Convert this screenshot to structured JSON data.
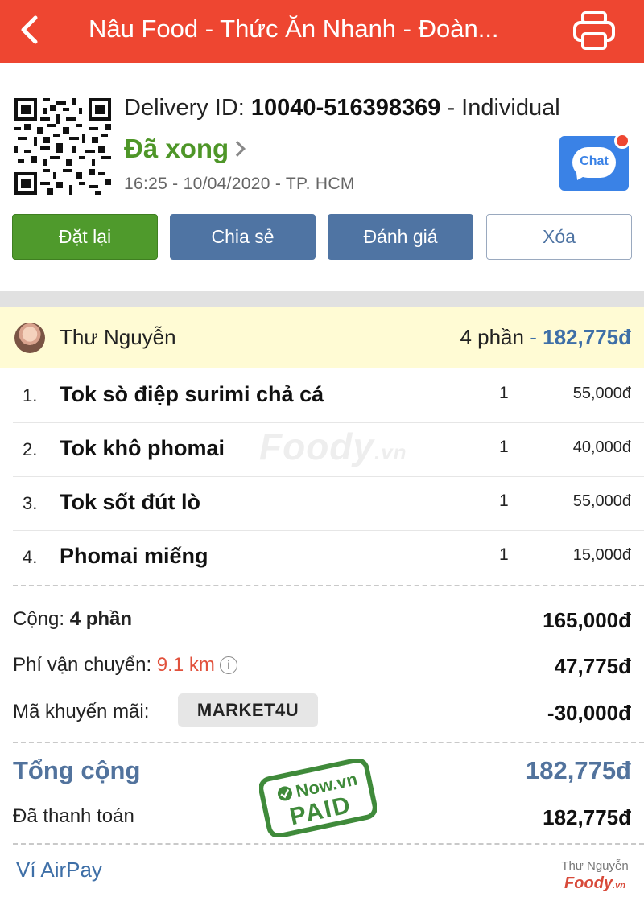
{
  "header": {
    "title": "Nâu Food - Thức Ăn Nhanh - Đoàn...",
    "back_icon": "chevron-left-icon",
    "print_icon": "printer-icon"
  },
  "order": {
    "delivery_prefix": "Delivery ID:",
    "delivery_id": "10040-516398369",
    "delivery_suffix": "- Individual",
    "status": "Đã xong",
    "meta": "16:25 - 10/04/2020 - TP. HCM",
    "chat_label": "Chat"
  },
  "actions": {
    "reorder": "Đặt lại",
    "share": "Chia sẻ",
    "rate": "Đánh giá",
    "delete": "Xóa"
  },
  "user": {
    "name": "Thư Nguyễn",
    "portions": "4 phần",
    "separator": "-",
    "amount": "182,775đ"
  },
  "items": [
    {
      "index": "1.",
      "name": "Tok sò điệp surimi chả cá",
      "qty": "1",
      "price": "55,000đ"
    },
    {
      "index": "2.",
      "name": "Tok khô phomai",
      "qty": "1",
      "price": "40,000đ"
    },
    {
      "index": "3.",
      "name": "Tok sốt đút lò",
      "qty": "1",
      "price": "55,000đ"
    },
    {
      "index": "4.",
      "name": "Phomai miếng",
      "qty": "1",
      "price": "15,000đ"
    }
  ],
  "watermark": {
    "brand": "Foody",
    "domain": ".vn"
  },
  "summary": {
    "subtotal_label": "Cộng:",
    "subtotal_count": "4 phần",
    "subtotal_value": "165,000đ",
    "shipping_label": "Phí vận chuyển:",
    "shipping_distance": "9.1 km",
    "shipping_info": "i",
    "shipping_value": "47,775đ",
    "promo_label": "Mã khuyến mãi:",
    "promo_code": "MARKET4U",
    "promo_value": "-30,000đ",
    "total_label": "Tổng cộng",
    "total_value": "182,775đ",
    "paid_label": "Đã thanh toán",
    "paid_value": "182,775đ"
  },
  "stamp": {
    "line1": "Now.vn",
    "line2": "PAID"
  },
  "footer": {
    "payment_method": "Ví AirPay",
    "corner_user": "Thư Nguyễn",
    "corner_brand": "Foody",
    "corner_domain": ".vn"
  },
  "colors": {
    "header": "#ee4631",
    "status_done": "#4e9628",
    "primary_blue": "#4f74a3",
    "accent_red": "#e1513c"
  }
}
